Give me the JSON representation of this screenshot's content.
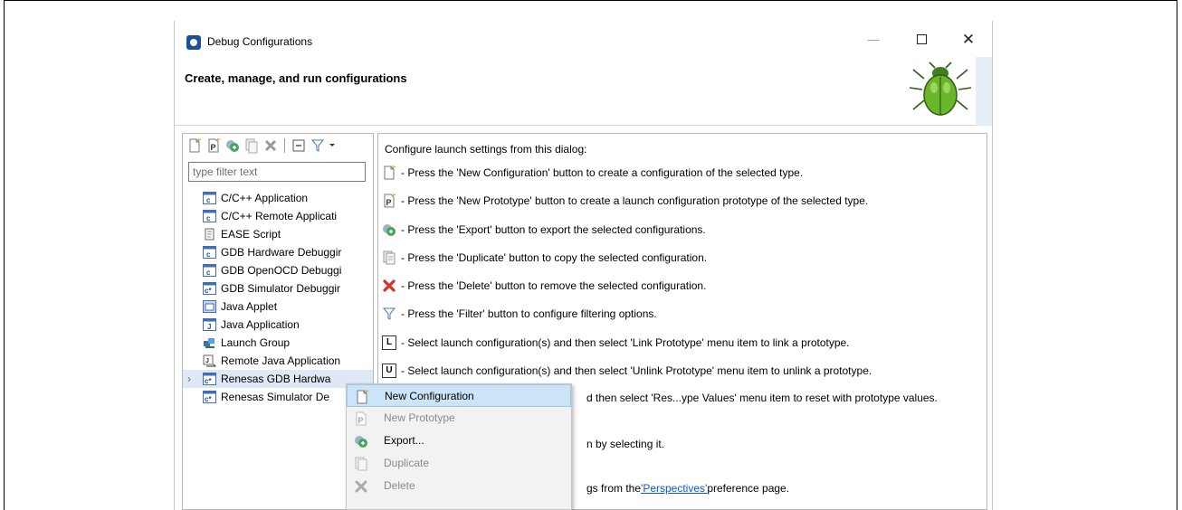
{
  "window": {
    "title": "Debug Configurations",
    "header_title": "Create, manage, and run configurations",
    "controls": {
      "minimize": "—",
      "close": "✕"
    }
  },
  "left": {
    "filter_placeholder": "type filter text",
    "toolbar_icons": [
      "new-configuration-icon",
      "new-prototype-icon",
      "export-icon",
      "duplicate-icon",
      "delete-icon",
      "collapse-all-icon",
      "filter-icon",
      "menu-dropdown-icon"
    ],
    "tree": [
      {
        "label": "C/C++ Application",
        "icon": "c-app-icon"
      },
      {
        "label": "C/C++ Remote Applicati",
        "icon": "c-remote-icon"
      },
      {
        "label": "EASE Script",
        "icon": "script-icon"
      },
      {
        "label": "GDB Hardware Debuggir",
        "icon": "c-hw-icon"
      },
      {
        "label": "GDB OpenOCD Debuggi",
        "icon": "c-openocd-icon"
      },
      {
        "label": "GDB Simulator Debuggir",
        "icon": "c-sim-icon"
      },
      {
        "label": "Java Applet",
        "icon": "java-applet-icon"
      },
      {
        "label": "Java Application",
        "icon": "java-app-icon"
      },
      {
        "label": "Launch Group",
        "icon": "launch-group-icon"
      },
      {
        "label": "Remote Java Application",
        "icon": "remote-java-icon"
      },
      {
        "label": "Renesas GDB Hardwa",
        "icon": "renesas-hw-icon"
      },
      {
        "label": "Renesas Simulator De",
        "icon": "renesas-sim-icon"
      }
    ],
    "expander": "›"
  },
  "right": {
    "intro": "Configure launch settings from this dialog:",
    "rows": [
      {
        "icon": "new-configuration-icon",
        "text": "- Press the 'New Configuration' button to create a configuration of the selected type."
      },
      {
        "icon": "new-prototype-icon",
        "text": "- Press the 'New Prototype' button to create a launch configuration prototype of the selected type."
      },
      {
        "icon": "export-icon",
        "text": "- Press the 'Export' button to export the selected configurations."
      },
      {
        "icon": "duplicate-icon",
        "text": "- Press the 'Duplicate' button to copy the selected configuration."
      },
      {
        "icon": "delete-icon",
        "text": "- Press the 'Delete' button to remove the selected configuration."
      },
      {
        "icon": "filter-icon",
        "text": "- Press the 'Filter' button to configure filtering options."
      },
      {
        "icon": "link-prototype-icon",
        "glyph": "L",
        "text": "- Select launch configuration(s) and then select 'Link Prototype' menu item to link a prototype."
      },
      {
        "icon": "unlink-prototype-icon",
        "glyph": "U",
        "text": "- Select launch configuration(s) and then select 'Unlink Prototype' menu item to unlink a prototype."
      },
      {
        "text": "d then select 'Res...ype Values' menu item to reset with prototype values."
      },
      {
        "text": "n by selecting it."
      },
      {
        "text": "gs from the ",
        "link": "'Perspectives'",
        "text_after": " preference page."
      }
    ]
  },
  "context_menu": {
    "items": [
      {
        "label": "New Configuration",
        "state": "hover",
        "icon": "new-configuration-icon"
      },
      {
        "label": "New Prototype",
        "state": "disabled",
        "icon": "new-prototype-icon"
      },
      {
        "label": "Export...",
        "state": "enabled",
        "icon": "export-icon"
      },
      {
        "label": "Duplicate",
        "state": "disabled",
        "icon": "duplicate-icon"
      },
      {
        "label": "Delete",
        "state": "disabled",
        "icon": "delete-icon"
      }
    ]
  },
  "colors": {
    "selection": "#dfe8f5",
    "menu_hover": "#cce4f7",
    "link": "#0b57d0",
    "delete_red": "#d93025",
    "bug_green": "#6bb52b"
  }
}
